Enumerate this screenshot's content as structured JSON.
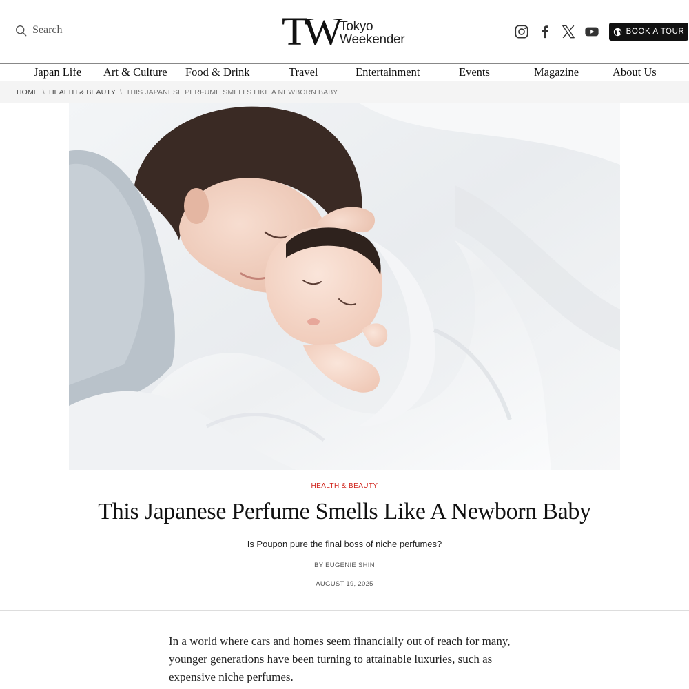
{
  "header": {
    "search_label": "Search",
    "logo": {
      "mark": "TW",
      "line1": "Tokyo",
      "line2": "Weekender"
    },
    "socials": [
      "instagram-icon",
      "facebook-icon",
      "x-icon",
      "youtube-icon"
    ],
    "book_label": "BOOK A TOUR"
  },
  "nav": {
    "items": [
      {
        "label": "Japan Life"
      },
      {
        "label": "Art & Culture"
      },
      {
        "label": "Food & Drink"
      },
      {
        "label": "Travel"
      },
      {
        "label": "Entertainment"
      },
      {
        "label": "Events"
      },
      {
        "label": "Magazine"
      },
      {
        "label": "About Us"
      }
    ]
  },
  "breadcrumb": {
    "home": "HOME",
    "section": "HEALTH & BEAUTY",
    "current": "THIS JAPANESE PERFUME SMELLS LIKE A NEWBORN BABY",
    "separator": "\\"
  },
  "article": {
    "category": "HEALTH & BEAUTY",
    "title": "This Japanese Perfume Smells Like A Newborn Baby",
    "subtitle": "Is Poupon pure the final boss of niche perfumes?",
    "byline_prefix": "BY ",
    "author": "EUGENIE SHIN",
    "date": "AUGUST 19, 2025",
    "body": "In a world where cars and homes seem financially out of reach for many, younger generations have been turning to attainable luxuries, such as expensive niche perfumes."
  },
  "colors": {
    "accent": "#d0241c",
    "text": "#111111",
    "breadcrumb_bg": "#f4f4f4",
    "button_bg": "#111111"
  }
}
